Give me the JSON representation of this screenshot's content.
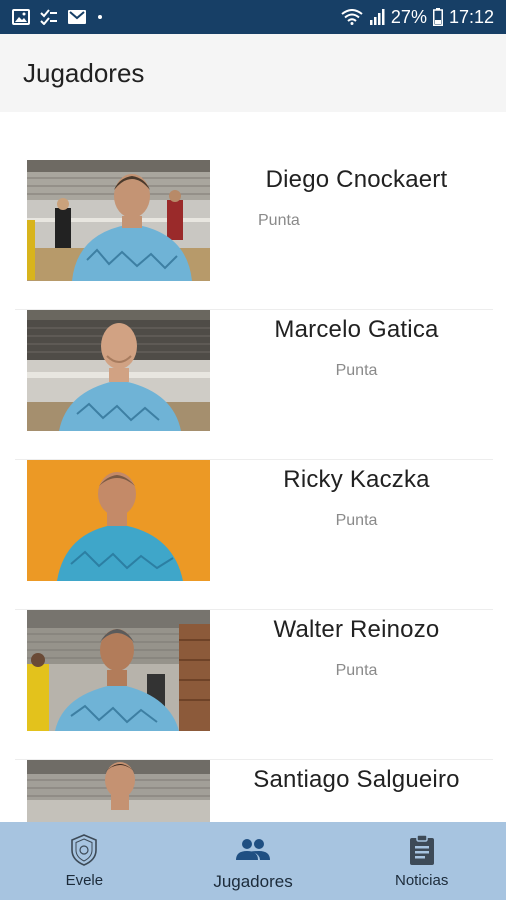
{
  "status_bar": {
    "battery": "27%",
    "time": "17:12"
  },
  "header": {
    "title": "Jugadores"
  },
  "players": [
    {
      "name": "Diego Cnockaert",
      "position": "Punta"
    },
    {
      "name": "Marcelo Gatica",
      "position": "Punta"
    },
    {
      "name": "Ricky Kaczka",
      "position": "Punta"
    },
    {
      "name": "Walter Reinozo",
      "position": "Punta"
    },
    {
      "name": "Santiago Salgueiro",
      "position": ""
    }
  ],
  "bottom_nav": {
    "items": [
      {
        "label": "Evele",
        "icon": "shield-icon"
      },
      {
        "label": "Jugadores",
        "icon": "people-icon"
      },
      {
        "label": "Noticias",
        "icon": "clipboard-icon"
      }
    ],
    "active": "Jugadores"
  },
  "colors": {
    "status_bar": "#173f66",
    "app_bar": "#f5f5f5",
    "bottom_nav": "#a7c4e0",
    "active_icon": "#1f4f82",
    "jersey": "#6fb3d6"
  }
}
